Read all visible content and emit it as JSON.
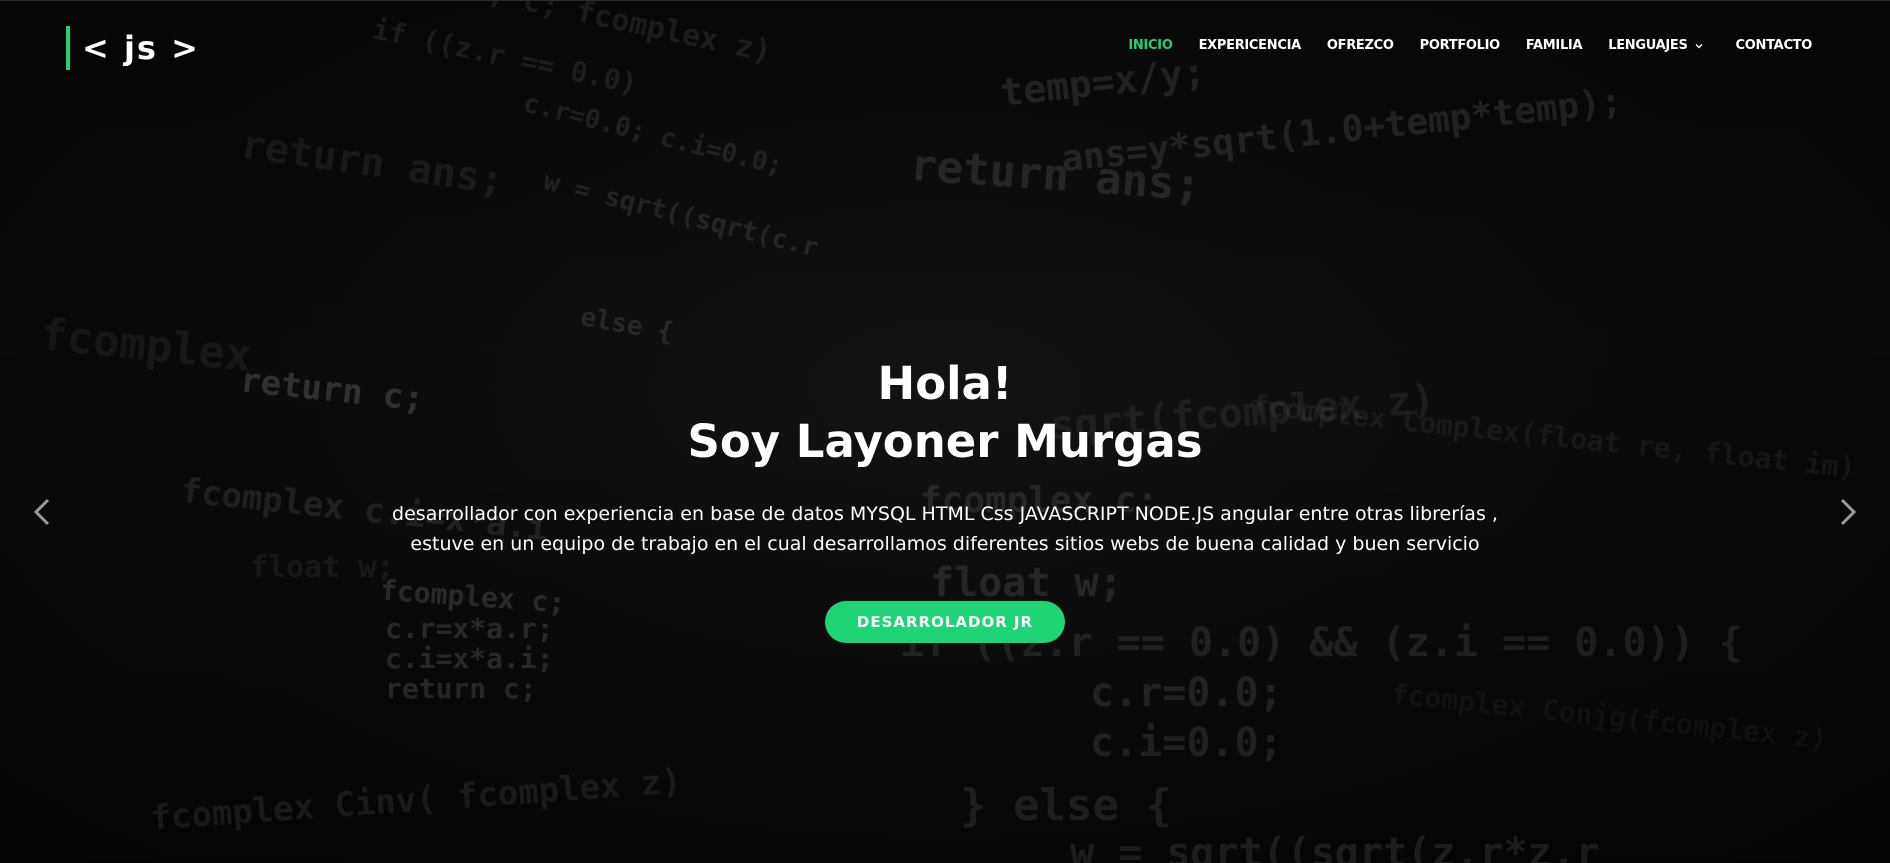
{
  "logo": {
    "text": "< js >"
  },
  "nav": {
    "items": [
      {
        "label": "INICIO",
        "active": true
      },
      {
        "label": "EXPERICENCIA"
      },
      {
        "label": "OFREZCO"
      },
      {
        "label": "PORTFOLIO"
      },
      {
        "label": "FAMILIA"
      },
      {
        "label": "LENGUAJES",
        "has_dropdown": true
      },
      {
        "label": "CONTACTO"
      }
    ]
  },
  "hero": {
    "greeting": "Hola!",
    "name_line": "Soy Layoner Murgas",
    "description_line1": "desarrollador con experiencia en base de datos MYSQL HTML Css JAVASCRIPT NODE.JS angular entre otras librerías ,",
    "description_line2": "estuve en un equipo de trabajo en el cual desarrollamos diferentes sitios webs de buena calidad y buen servicio",
    "cta_label": "DESARROLADOR JR"
  },
  "slider": {
    "prev_icon": "chevron-left-icon",
    "next_icon": "chevron-right-icon"
  },
  "colors": {
    "accent": "#1fd474",
    "background": "#050505",
    "text": "#ffffff"
  }
}
